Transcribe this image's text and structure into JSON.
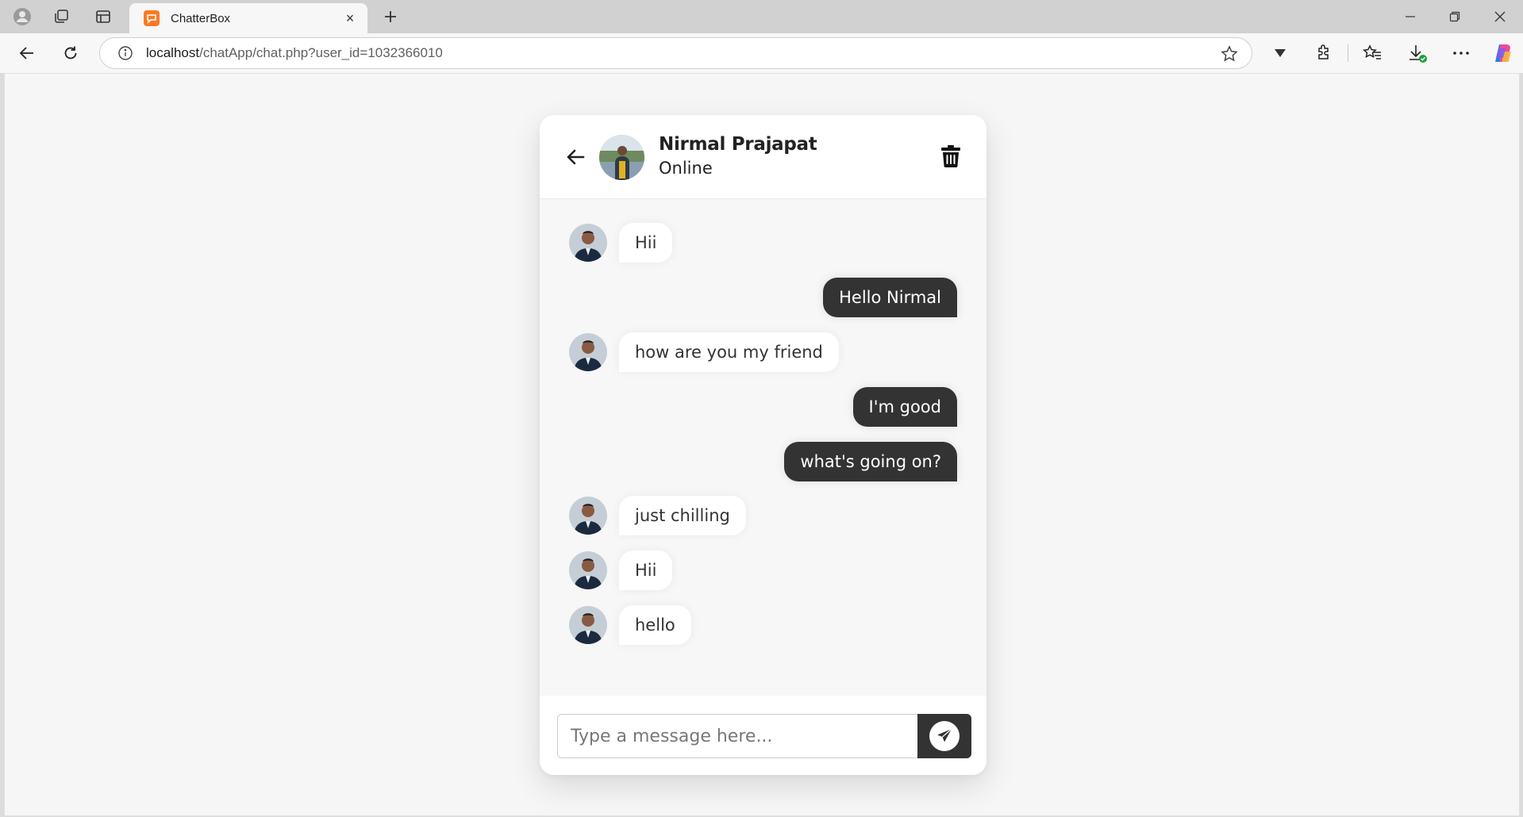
{
  "browser": {
    "tab_title": "ChatterBox",
    "tab_close": "×",
    "url_host": "localhost",
    "url_path": "/chatApp/chat.php?user_id=1032366010"
  },
  "chat": {
    "contact_name": "Nirmal Prajapat",
    "contact_status": "Online",
    "messages": [
      {
        "direction": "incoming",
        "text": "Hii"
      },
      {
        "direction": "outgoing",
        "text": "Hello Nirmal"
      },
      {
        "direction": "incoming",
        "text": "how are you my friend"
      },
      {
        "direction": "outgoing",
        "text": "I'm good"
      },
      {
        "direction": "outgoing",
        "text": "what's going on?"
      },
      {
        "direction": "incoming",
        "text": "just chilling"
      },
      {
        "direction": "incoming",
        "text": "Hii"
      },
      {
        "direction": "incoming",
        "text": "hello"
      }
    ],
    "input_placeholder": "Type a message here..."
  },
  "icons": {
    "back": "arrow-left-icon",
    "delete": "trash-icon",
    "send": "send-icon"
  },
  "colors": {
    "outgoing_bubble": "#333333",
    "incoming_bubble": "#ffffff",
    "send_button": "#333333",
    "tab_favicon": "#fb7a24"
  }
}
